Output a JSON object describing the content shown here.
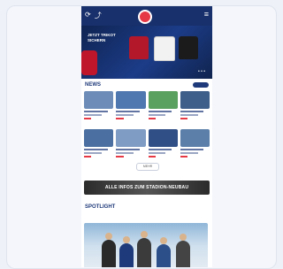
{
  "phone_app": {
    "hero": {
      "promo_text": "JETZT TRIKOT SICHERN"
    },
    "news": {
      "section_title": "NEWS",
      "load_more_label": "MEHR"
    },
    "banner": {
      "text": "ALLE INFOS ZUM STADION-NEUBAU"
    },
    "spotlight": {
      "section_title": "SPOTLIGHT"
    },
    "colors": {
      "brand_navy": "#18306b",
      "accent_red": "#e63946"
    }
  }
}
